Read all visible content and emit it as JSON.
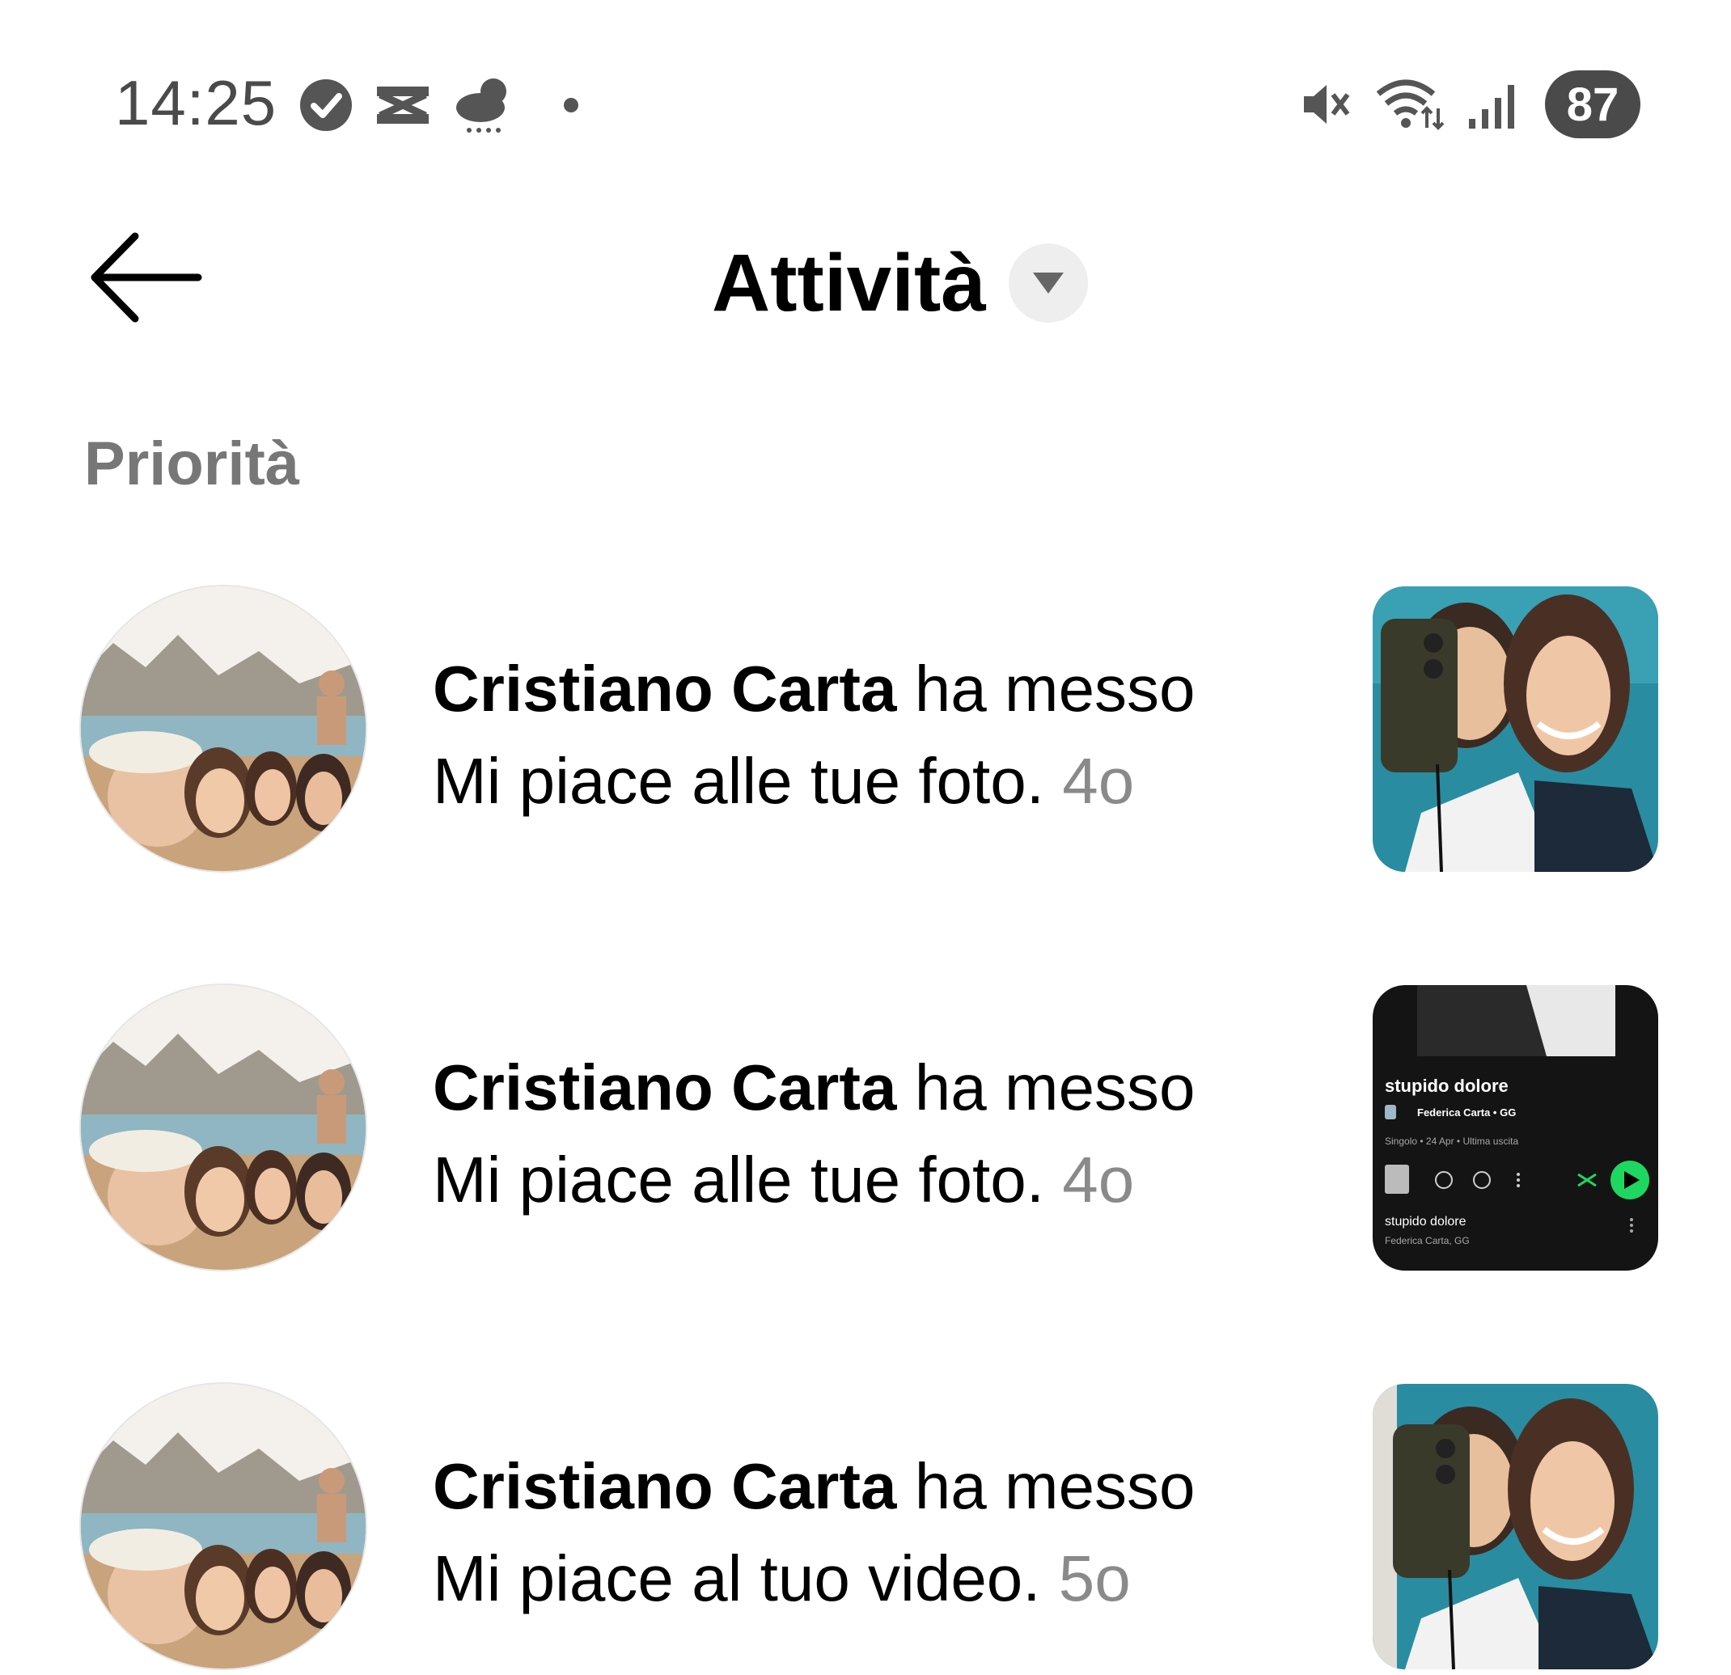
{
  "status_bar": {
    "time": "14:25",
    "left_icons": [
      "check-circle-icon",
      "capcut-icon",
      "weather-rain-icon",
      "dot-icon"
    ],
    "right_icons": [
      "mute-icon",
      "wifi-icon",
      "signal-icon"
    ],
    "battery": "87"
  },
  "header": {
    "title": "Attività",
    "back_icon": "arrow-left-icon",
    "dropdown_icon": "triangle-down-icon"
  },
  "section": {
    "title": "Priorità"
  },
  "notifications": [
    {
      "name": "Cristiano Carta",
      "action": " ha messo Mi piace alle tue foto.",
      "age": "4o",
      "thumbnail": "selfie-photo"
    },
    {
      "name": "Cristiano Carta",
      "action": " ha messo Mi piace alle tue foto.",
      "age": "4o",
      "thumbnail": "music-card",
      "music_card": {
        "title": "stupido dolore",
        "artists": "Federica Carta • GG",
        "meta": "Singolo • 24 Apr • Ultima uscita",
        "track_title": "stupido dolore",
        "track_artists": "Federica Carta, GG"
      }
    },
    {
      "name": "Cristiano Carta",
      "action": " ha messo Mi piace al tuo video.",
      "age": "5o",
      "thumbnail": "selfie-video"
    }
  ],
  "colors": {
    "background": "#ffffff",
    "text": "#000000",
    "muted": "#8a8a8a",
    "section": "#777777",
    "spotify_green": "#1ed760"
  }
}
